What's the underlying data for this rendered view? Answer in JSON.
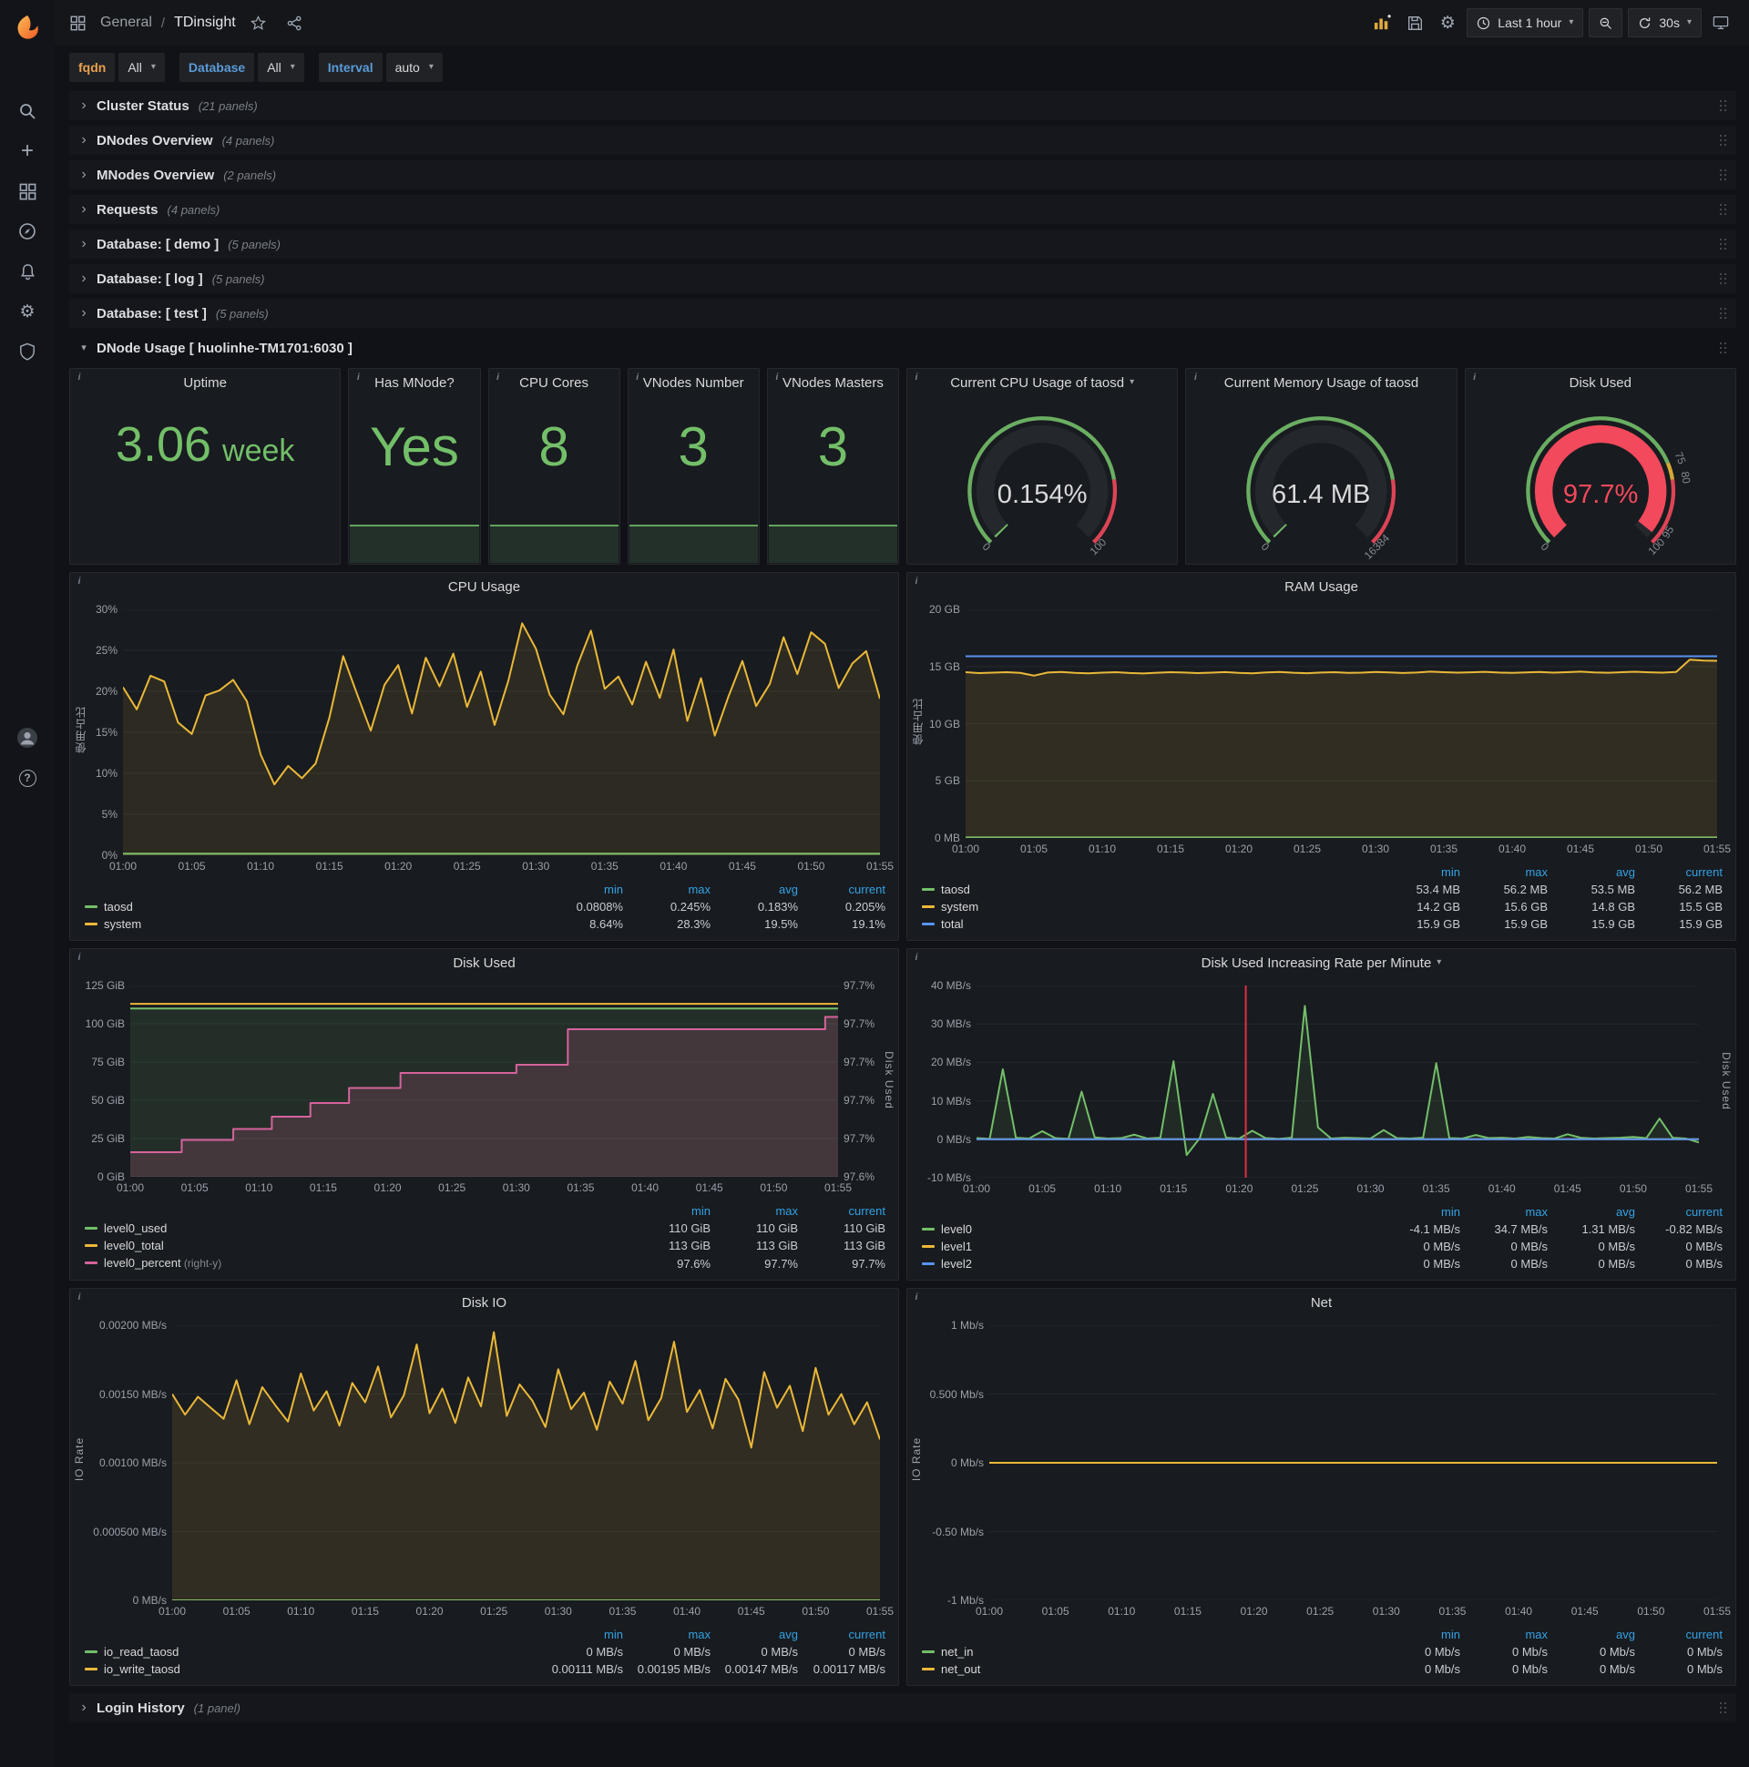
{
  "colors": {
    "green": "#73BF69",
    "yellow": "#EAB839",
    "blue": "#5794F2",
    "pink": "#D6639C",
    "red": "#F2495C",
    "annotation_red": "#E02F44",
    "accent_orange": "#EB7B18"
  },
  "icons": {
    "caret": "▾",
    "chevron_collapsed": "›",
    "chevron_expanded": "▾",
    "gear": "⚙",
    "plus": "+",
    "help_glyph": "?",
    "info_glyph": "i",
    "slash": "/"
  },
  "nav": {
    "breadcrumb_section": "General",
    "breadcrumb_page": "TDinsight",
    "time_range_label": "Last 1 hour",
    "refresh_label": "30s"
  },
  "variables": [
    {
      "label": "fqdn",
      "label_color": "#E8A04C",
      "value": "All"
    },
    {
      "label": "Database",
      "label_color": "#5A9BD8",
      "value": "All"
    },
    {
      "label": "Interval",
      "label_color": "#5A9BD8",
      "value": "auto"
    }
  ],
  "rows": [
    {
      "title": "Cluster Status",
      "count": "(21 panels)"
    },
    {
      "title": "DNodes Overview",
      "count": "(4 panels)"
    },
    {
      "title": "MNodes Overview",
      "count": "(2 panels)"
    },
    {
      "title": "Requests",
      "count": "(4 panels)"
    },
    {
      "title": "Database: [ demo ]",
      "count": "(5 panels)"
    },
    {
      "title": "Database: [ log ]",
      "count": "(5 panels)"
    },
    {
      "title": "Database: [ test ]",
      "count": "(5 panels)"
    }
  ],
  "expanded_row": {
    "title": "DNode Usage [ huolinhe-TM1701:6030 ]"
  },
  "login_row": {
    "title": "Login History",
    "count": "(1 panel)"
  },
  "stats": [
    {
      "title": "Uptime",
      "value": "3.06",
      "unit": "week"
    },
    {
      "title": "Has MNode?",
      "value": "Yes",
      "unit": ""
    },
    {
      "title": "CPU Cores",
      "value": "8",
      "unit": ""
    },
    {
      "title": "VNodes Number",
      "value": "3",
      "unit": ""
    },
    {
      "title": "VNodes Masters",
      "value": "3",
      "unit": ""
    }
  ],
  "gauges": [
    {
      "title": "Current CPU Usage of taosd",
      "value": "0.154%",
      "percent": 0.154,
      "color": "#73BF69",
      "value_color": "#d8d9da",
      "band": [
        {
          "v0": 0,
          "v1": 80,
          "color": "#73BF69"
        },
        {
          "v0": 80,
          "v1": 100,
          "color": "#F2495C"
        }
      ],
      "labels": [
        {
          "text": "0",
          "v": 0
        },
        {
          "text": "100",
          "v": 100
        }
      ]
    },
    {
      "title": "Current Memory Usage of taosd",
      "value": "61.4 MB",
      "percent": 0.375,
      "color": "#73BF69",
      "value_color": "#d8d9da",
      "band": [
        {
          "v0": 0,
          "v1": 80,
          "color": "#73BF69"
        },
        {
          "v0": 80,
          "v1": 100,
          "color": "#F2495C"
        }
      ],
      "labels": [
        {
          "text": "0",
          "v": 0
        },
        {
          "text": "16384",
          "v": 100
        }
      ]
    },
    {
      "title": "Disk Used",
      "value": "97.7%",
      "percent": 97.7,
      "color": "#F2495C",
      "value_color": "#F2495C",
      "band": [
        {
          "v0": 0,
          "v1": 75,
          "color": "#73BF69"
        },
        {
          "v0": 75,
          "v1": 80,
          "color": "#EAB839"
        },
        {
          "v0": 80,
          "v1": 100,
          "color": "#F2495C"
        }
      ],
      "labels": [
        {
          "text": "0",
          "v": 0
        },
        {
          "text": "75",
          "v": 75
        },
        {
          "text": "80",
          "v": 80
        },
        {
          "text": "95",
          "v": 95
        },
        {
          "text": "100",
          "v": 100
        }
      ]
    }
  ],
  "chart_data": [
    {
      "id": "cpu_usage",
      "type": "line",
      "title": "CPU Usage",
      "ylabel": "使用占比",
      "ylim": [
        0,
        30
      ],
      "axis_w": 58,
      "right_pad": 20,
      "y_ticks": [
        "0%",
        "5%",
        "10%",
        "15%",
        "20%",
        "25%",
        "30%"
      ],
      "x_ticks": [
        "01:00",
        "01:05",
        "01:10",
        "01:15",
        "01:20",
        "01:25",
        "01:30",
        "01:35",
        "01:40",
        "01:45",
        "01:50",
        "01:55"
      ],
      "series": [
        {
          "name": "taosd",
          "color": "#73BF69",
          "fill": 0.08,
          "const": 0.2
        },
        {
          "name": "system",
          "color": "#EAB839",
          "fill": 0.1,
          "values": [
            20.5,
            17.8,
            21.9,
            21.2,
            16.2,
            14.8,
            19.5,
            20.1,
            21.4,
            18.8,
            12.3,
            8.64,
            10.9,
            9.4,
            11.2,
            16.8,
            24.3,
            19.7,
            15.2,
            20.8,
            23.2,
            17.3,
            24.1,
            20.6,
            24.6,
            18.1,
            22.4,
            15.9,
            21.3,
            28.3,
            25.2,
            19.6,
            17.2,
            23.1,
            27.4,
            20.3,
            21.8,
            18.4,
            23.6,
            19.2,
            25.1,
            16.4,
            21.6,
            14.6,
            19.4,
            23.7,
            18.2,
            20.9,
            26.6,
            22.1,
            27.2,
            25.8,
            20.4,
            23.4,
            24.9,
            19.1
          ]
        }
      ],
      "legend": {
        "columns": [
          "min",
          "max",
          "avg",
          "current"
        ],
        "rows": [
          {
            "name": "taosd",
            "color": "#73BF69",
            "values": [
              "0.0808%",
              "0.245%",
              "0.183%",
              "0.205%"
            ]
          },
          {
            "name": "system",
            "color": "#EAB839",
            "values": [
              "8.64%",
              "28.3%",
              "19.5%",
              "19.1%"
            ]
          }
        ]
      }
    },
    {
      "id": "ram_usage",
      "type": "line",
      "title": "RAM Usage",
      "ylabel": "使用占比",
      "ylim": [
        0,
        20
      ],
      "axis_w": 64,
      "right_pad": 20,
      "y_ticks": [
        "0 MB",
        "5 GB",
        "10 GB",
        "15 GB",
        "20 GB"
      ],
      "x_ticks": [
        "01:00",
        "01:05",
        "01:10",
        "01:15",
        "01:20",
        "01:25",
        "01:30",
        "01:35",
        "01:40",
        "01:45",
        "01:50",
        "01:55"
      ],
      "series": [
        {
          "name": "taosd",
          "color": "#73BF69",
          "fill": 0.1,
          "const": 0.055
        },
        {
          "name": "system",
          "color": "#EAB839",
          "fill": 0.12,
          "values": [
            14.5,
            14.42,
            14.46,
            14.5,
            14.44,
            14.2,
            14.47,
            14.52,
            14.44,
            14.4,
            14.46,
            14.5,
            14.43,
            14.39,
            14.45,
            14.5,
            14.47,
            14.42,
            14.46,
            14.51,
            14.44,
            14.4,
            14.48,
            14.52,
            14.45,
            14.41,
            14.47,
            14.5,
            14.44,
            14.46,
            14.52,
            14.48,
            14.43,
            14.47,
            14.55,
            14.5,
            14.46,
            14.49,
            14.53,
            14.47,
            14.44,
            14.48,
            14.52,
            14.46,
            14.5,
            14.55,
            14.48,
            14.45,
            14.5,
            14.54,
            14.49,
            14.46,
            14.52,
            15.6,
            15.52,
            15.5
          ]
        },
        {
          "name": "total",
          "color": "#5794F2",
          "fill": 0,
          "const": 15.9
        }
      ],
      "legend": {
        "columns": [
          "min",
          "max",
          "avg",
          "current"
        ],
        "rows": [
          {
            "name": "taosd",
            "color": "#73BF69",
            "values": [
              "53.4 MB",
              "56.2 MB",
              "53.5 MB",
              "56.2 MB"
            ]
          },
          {
            "name": "system",
            "color": "#EAB839",
            "values": [
              "14.2 GB",
              "15.6 GB",
              "14.8 GB",
              "15.5 GB"
            ]
          },
          {
            "name": "total",
            "color": "#5794F2",
            "values": [
              "15.9 GB",
              "15.9 GB",
              "15.9 GB",
              "15.9 GB"
            ]
          }
        ]
      }
    },
    {
      "id": "disk_used",
      "type": "line",
      "title": "Disk Used",
      "ylim": [
        0,
        125
      ],
      "right_ylim": [
        97.58,
        97.72
      ],
      "axis_w": 66,
      "right_pad": 66,
      "right_label": "Disk Used",
      "y_ticks": [
        "0 GiB",
        "25 GiB",
        "50 GiB",
        "75 GiB",
        "100 GiB",
        "125 GiB"
      ],
      "right_y_ticks": [
        "97.6%",
        "97.7%",
        "97.7%",
        "97.7%",
        "97.7%",
        "97.7%"
      ],
      "x_ticks": [
        "01:00",
        "01:05",
        "01:10",
        "01:15",
        "01:20",
        "01:25",
        "01:30",
        "01:35",
        "01:40",
        "01:45",
        "01:50",
        "01:55"
      ],
      "series": [
        {
          "name": "level0_used",
          "color": "#73BF69",
          "fill": 0.12,
          "const": 110
        },
        {
          "name": "level0_total",
          "color": "#EAB839",
          "fill": 0,
          "const": 113
        },
        {
          "name": "level0_percent",
          "color": "#D6639C",
          "fill": 0.18,
          "axis": "right",
          "step": true,
          "values": [
            97.598,
            97.598,
            97.598,
            97.598,
            97.607,
            97.607,
            97.607,
            97.607,
            97.615,
            97.615,
            97.615,
            97.624,
            97.624,
            97.624,
            97.634,
            97.634,
            97.634,
            97.645,
            97.645,
            97.645,
            97.645,
            97.656,
            97.656,
            97.656,
            97.656,
            97.656,
            97.656,
            97.656,
            97.656,
            97.656,
            97.662,
            97.662,
            97.662,
            97.662,
            97.688,
            97.688,
            97.688,
            97.688,
            97.688,
            97.688,
            97.688,
            97.688,
            97.688,
            97.688,
            97.688,
            97.688,
            97.688,
            97.688,
            97.688,
            97.688,
            97.688,
            97.688,
            97.688,
            97.688,
            97.697,
            97.697
          ]
        }
      ],
      "legend": {
        "columns": [
          "min",
          "max",
          "current"
        ],
        "rows": [
          {
            "name": "level0_used",
            "color": "#73BF69",
            "values": [
              "110 GiB",
              "110 GiB",
              "110 GiB"
            ]
          },
          {
            "name": "level0_total",
            "color": "#EAB839",
            "values": [
              "113 GiB",
              "113 GiB",
              "113 GiB"
            ]
          },
          {
            "name": "level0_percent",
            "color": "#D6639C",
            "note": "(right-y)",
            "values": [
              "97.6%",
              "97.7%",
              "97.7%"
            ]
          }
        ]
      }
    },
    {
      "id": "disk_rate",
      "type": "line",
      "title": "Disk Used Increasing Rate per Minute",
      "ylim": [
        -10,
        40
      ],
      "axis_w": 76,
      "right_pad": 40,
      "annotation_min": 20.5,
      "right_label": "Disk Used",
      "y_ticks": [
        "-10 MB/s",
        "0 MB/s",
        "10 MB/s",
        "20 MB/s",
        "30 MB/s",
        "40 MB/s"
      ],
      "x_ticks": [
        "01:00",
        "01:05",
        "01:10",
        "01:15",
        "01:20",
        "01:25",
        "01:30",
        "01:35",
        "01:40",
        "01:45",
        "01:50",
        "01:55"
      ],
      "series": [
        {
          "name": "level0",
          "color": "#73BF69",
          "fill": 0.1,
          "values": [
            0.3,
            0.1,
            18.2,
            0.4,
            0.2,
            2.1,
            0.3,
            0.1,
            12.4,
            0.5,
            0.2,
            0.3,
            1.2,
            0.2,
            0.4,
            20.3,
            -4.1,
            0.3,
            11.8,
            0.4,
            0.2,
            2.2,
            0.3,
            0.1,
            0.4,
            34.7,
            3.1,
            0.2,
            0.4,
            0.3,
            0.2,
            2.4,
            0.3,
            0.2,
            0.4,
            19.8,
            0.3,
            0.2,
            1.1,
            0.3,
            0.4,
            0.2,
            0.6,
            0.3,
            0.2,
            1.3,
            0.4,
            0.2,
            0.3,
            0.4,
            0.6,
            0.3,
            5.4,
            0.4,
            0.2,
            -0.82
          ]
        },
        {
          "name": "level1",
          "color": "#EAB839",
          "fill": 0,
          "const": 0
        },
        {
          "name": "level2",
          "color": "#5794F2",
          "fill": 0,
          "const": 0
        }
      ],
      "legend": {
        "columns": [
          "min",
          "max",
          "avg",
          "current"
        ],
        "rows": [
          {
            "name": "level0",
            "color": "#73BF69",
            "values": [
              "-4.1 MB/s",
              "34.7 MB/s",
              "1.31 MB/s",
              "-0.82 MB/s"
            ]
          },
          {
            "name": "level1",
            "color": "#EAB839",
            "values": [
              "0 MB/s",
              "0 MB/s",
              "0 MB/s",
              "0 MB/s"
            ]
          },
          {
            "name": "level2",
            "color": "#5794F2",
            "values": [
              "0 MB/s",
              "0 MB/s",
              "0 MB/s",
              "0 MB/s"
            ]
          }
        ]
      }
    },
    {
      "id": "disk_io",
      "type": "line",
      "title": "Disk IO",
      "ylabel": "IO Rate",
      "ylim": [
        0,
        0.002
      ],
      "axis_w": 112,
      "right_pad": 20,
      "y_ticks": [
        "0 MB/s",
        "0.000500 MB/s",
        "0.00100 MB/s",
        "0.00150 MB/s",
        "0.00200 MB/s"
      ],
      "x_ticks": [
        "01:00",
        "01:05",
        "01:10",
        "01:15",
        "01:20",
        "01:25",
        "01:30",
        "01:35",
        "01:40",
        "01:45",
        "01:50",
        "01:55"
      ],
      "series": [
        {
          "name": "io_read_taosd",
          "color": "#73BF69",
          "fill": 0,
          "const": 0
        },
        {
          "name": "io_write_taosd",
          "color": "#EAB839",
          "fill": 0.12,
          "values": [
            0.0015,
            0.00135,
            0.00148,
            0.0014,
            0.00132,
            0.0016,
            0.00128,
            0.00155,
            0.00142,
            0.0013,
            0.00165,
            0.00138,
            0.00152,
            0.00127,
            0.00158,
            0.00144,
            0.0017,
            0.00133,
            0.00149,
            0.00186,
            0.00136,
            0.00154,
            0.00129,
            0.00162,
            0.00141,
            0.00195,
            0.00134,
            0.00157,
            0.00145,
            0.00126,
            0.00168,
            0.00139,
            0.00151,
            0.00124,
            0.00159,
            0.00143,
            0.00174,
            0.00131,
            0.00147,
            0.00188,
            0.00137,
            0.00153,
            0.00125,
            0.00161,
            0.00146,
            0.00111,
            0.00166,
            0.0014,
            0.00156,
            0.00123,
            0.00169,
            0.00135,
            0.0015,
            0.00128,
            0.00144,
            0.00117
          ]
        }
      ],
      "legend": {
        "columns": [
          "min",
          "max",
          "avg",
          "current"
        ],
        "rows": [
          {
            "name": "io_read_taosd",
            "color": "#73BF69",
            "values": [
              "0 MB/s",
              "0 MB/s",
              "0 MB/s",
              "0 MB/s"
            ]
          },
          {
            "name": "io_write_taosd",
            "color": "#EAB839",
            "values": [
              "0.00111 MB/s",
              "0.00195 MB/s",
              "0.00147 MB/s",
              "0.00117 MB/s"
            ]
          }
        ]
      }
    },
    {
      "id": "net",
      "type": "line",
      "title": "Net",
      "ylabel": "IO Rate",
      "ylim": [
        -1,
        1
      ],
      "axis_w": 90,
      "right_pad": 20,
      "y_ticks": [
        "-1 Mb/s",
        "-0.50 Mb/s",
        "0 Mb/s",
        "0.500 Mb/s",
        "1 Mb/s"
      ],
      "x_ticks": [
        "01:00",
        "01:05",
        "01:10",
        "01:15",
        "01:20",
        "01:25",
        "01:30",
        "01:35",
        "01:40",
        "01:45",
        "01:50",
        "01:55"
      ],
      "series": [
        {
          "name": "net_in",
          "color": "#73BF69",
          "fill": 0,
          "const": 0
        },
        {
          "name": "net_out",
          "color": "#EAB839",
          "fill": 0,
          "const": 0
        }
      ],
      "legend": {
        "columns": [
          "min",
          "max",
          "avg",
          "current"
        ],
        "rows": [
          {
            "name": "net_in",
            "color": "#73BF69",
            "values": [
              "0 Mb/s",
              "0 Mb/s",
              "0 Mb/s",
              "0 Mb/s"
            ]
          },
          {
            "name": "net_out",
            "color": "#EAB839",
            "values": [
              "0 Mb/s",
              "0 Mb/s",
              "0 Mb/s",
              "0 Mb/s"
            ]
          }
        ]
      }
    }
  ]
}
